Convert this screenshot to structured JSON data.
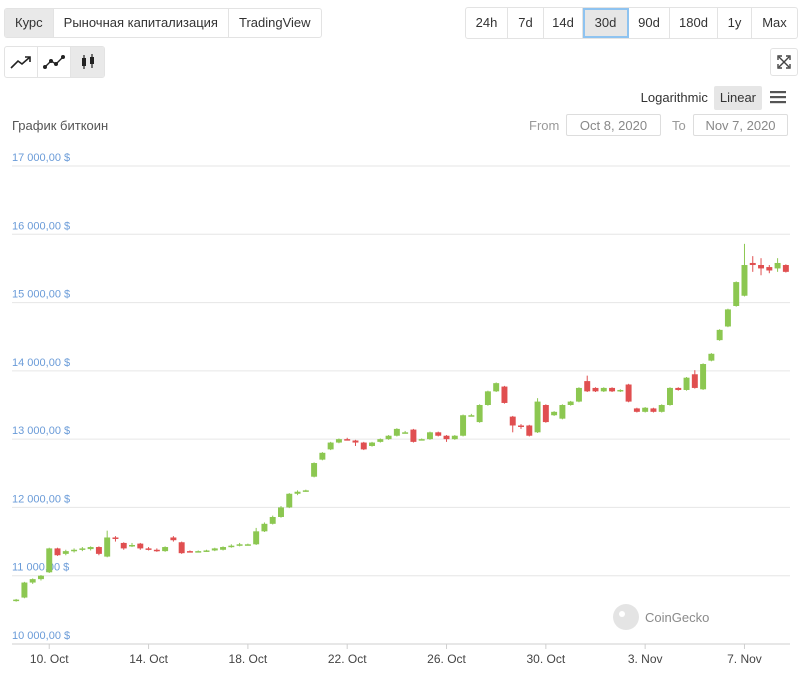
{
  "tabs": [
    "Курс",
    "Рыночная капитализация",
    "TradingView"
  ],
  "ranges": [
    "24h",
    "7d",
    "14d",
    "30d",
    "90d",
    "180d",
    "1y",
    "Max"
  ],
  "selected_range": "30d",
  "chart_types": [
    "line-chart-icon",
    "line-markers-icon",
    "candlestick-icon"
  ],
  "scale": {
    "logarithmic": "Logarithmic",
    "linear": "Linear",
    "active": "linear"
  },
  "title": "График биткоин",
  "from_label": "From",
  "from_value": "Oct 8, 2020",
  "to_label": "To",
  "to_value": "Nov 7, 2020",
  "credit": "CoinGecko",
  "colors": {
    "up": "#8cc751",
    "down": "#e04f50",
    "grid": "#e6e6e6",
    "ytick": "#6a9bd8",
    "selected_border": "#8ec3f0"
  },
  "chart_data": {
    "type": "candlestick",
    "ylim": [
      10000,
      17000
    ],
    "yticks": [
      "10 000,00 $",
      "11 000,00 $",
      "12 000,00 $",
      "13 000,00 $",
      "14 000,00 $",
      "15 000,00 $",
      "16 000,00 $",
      "17 000,00 $"
    ],
    "ytick_values": [
      10000,
      11000,
      12000,
      13000,
      14000,
      15000,
      16000,
      17000
    ],
    "xticks": [
      "10. Oct",
      "14. Oct",
      "18. Oct",
      "22. Oct",
      "26. Oct",
      "30. Oct",
      "3. Nov",
      "7. Nov"
    ],
    "xtick_index": [
      4,
      16,
      28,
      40,
      52,
      64,
      76,
      88
    ],
    "candles": [
      [
        10640,
        10650,
        10620,
        10660
      ],
      [
        10680,
        10900,
        10670,
        10910
      ],
      [
        10900,
        10950,
        10880,
        10960
      ],
      [
        10950,
        11000,
        10930,
        11010
      ],
      [
        11050,
        11400,
        11040,
        11410
      ],
      [
        11400,
        11300,
        11290,
        11410
      ],
      [
        11320,
        11360,
        11300,
        11380
      ],
      [
        11360,
        11380,
        11340,
        11400
      ],
      [
        11380,
        11400,
        11360,
        11420
      ],
      [
        11390,
        11420,
        11370,
        11430
      ],
      [
        11420,
        11320,
        11300,
        11430
      ],
      [
        11280,
        11560,
        11270,
        11660
      ],
      [
        11560,
        11540,
        11500,
        11580
      ],
      [
        11480,
        11400,
        11380,
        11490
      ],
      [
        11430,
        11450,
        11420,
        11480
      ],
      [
        11470,
        11400,
        11380,
        11480
      ],
      [
        11400,
        11380,
        11370,
        11420
      ],
      [
        11380,
        11360,
        11350,
        11400
      ],
      [
        11360,
        11420,
        11350,
        11430
      ],
      [
        11560,
        11520,
        11500,
        11580
      ],
      [
        11490,
        11330,
        11320,
        11500
      ],
      [
        11360,
        11350,
        11340,
        11370
      ],
      [
        11350,
        11360,
        11340,
        11370
      ],
      [
        11360,
        11370,
        11350,
        11380
      ],
      [
        11370,
        11400,
        11360,
        11410
      ],
      [
        11380,
        11420,
        11370,
        11430
      ],
      [
        11420,
        11440,
        11410,
        11460
      ],
      [
        11440,
        11460,
        11430,
        11480
      ],
      [
        11460,
        11460,
        11450,
        11470
      ],
      [
        11460,
        11650,
        11450,
        11700
      ],
      [
        11650,
        11760,
        11640,
        11780
      ],
      [
        11760,
        11860,
        11750,
        11880
      ],
      [
        11860,
        12000,
        11850,
        12020
      ],
      [
        12000,
        12200,
        11990,
        12210
      ],
      [
        12200,
        12230,
        12180,
        12250
      ],
      [
        12240,
        12250,
        12230,
        12260
      ],
      [
        12450,
        12650,
        12440,
        12660
      ],
      [
        12700,
        12800,
        12690,
        12810
      ],
      [
        12850,
        12950,
        12840,
        12960
      ],
      [
        12950,
        13000,
        12940,
        13010
      ],
      [
        13000,
        12990,
        12980,
        13020
      ],
      [
        12980,
        12950,
        12900,
        12990
      ],
      [
        12950,
        12850,
        12840,
        12960
      ],
      [
        12900,
        12950,
        12890,
        12960
      ],
      [
        12960,
        13000,
        12950,
        13010
      ],
      [
        13000,
        13050,
        12990,
        13060
      ],
      [
        13050,
        13150,
        13040,
        13160
      ],
      [
        13100,
        13100,
        13090,
        13120
      ],
      [
        13140,
        12960,
        12950,
        13150
      ],
      [
        13000,
        13000,
        12990,
        13010
      ],
      [
        13000,
        13100,
        12990,
        13110
      ],
      [
        13100,
        13050,
        13040,
        13110
      ],
      [
        13050,
        13000,
        12960,
        13060
      ],
      [
        13000,
        13050,
        12990,
        13060
      ],
      [
        13050,
        13350,
        13040,
        13360
      ],
      [
        13350,
        13350,
        13340,
        13370
      ],
      [
        13250,
        13500,
        13240,
        13510
      ],
      [
        13500,
        13700,
        13490,
        13710
      ],
      [
        13700,
        13820,
        13690,
        13830
      ],
      [
        13770,
        13530,
        13520,
        13780
      ],
      [
        13330,
        13200,
        13100,
        13340
      ],
      [
        13200,
        13180,
        13150,
        13220
      ],
      [
        13200,
        13050,
        13040,
        13210
      ],
      [
        13100,
        13550,
        13090,
        13600
      ],
      [
        13500,
        13250,
        13240,
        13510
      ],
      [
        13350,
        13400,
        13340,
        13410
      ],
      [
        13300,
        13500,
        13290,
        13510
      ],
      [
        13500,
        13550,
        13490,
        13560
      ],
      [
        13550,
        13750,
        13540,
        13760
      ],
      [
        13850,
        13700,
        13690,
        13930
      ],
      [
        13750,
        13700,
        13690,
        13760
      ],
      [
        13700,
        13750,
        13690,
        13760
      ],
      [
        13750,
        13700,
        13690,
        13760
      ],
      [
        13700,
        13720,
        13690,
        13730
      ],
      [
        13800,
        13550,
        13540,
        13810
      ],
      [
        13450,
        13400,
        13390,
        13460
      ],
      [
        13400,
        13460,
        13390,
        13470
      ],
      [
        13450,
        13400,
        13390,
        13460
      ],
      [
        13400,
        13500,
        13390,
        13510
      ],
      [
        13500,
        13750,
        13490,
        13760
      ],
      [
        13750,
        13720,
        13710,
        13760
      ],
      [
        13720,
        13900,
        13710,
        13910
      ],
      [
        13950,
        13750,
        13740,
        14010
      ],
      [
        13730,
        14100,
        13720,
        14110
      ],
      [
        14150,
        14250,
        14140,
        14260
      ],
      [
        14450,
        14600,
        14440,
        14610
      ],
      [
        14650,
        14900,
        14640,
        14910
      ],
      [
        14950,
        15300,
        14940,
        15310
      ],
      [
        15100,
        15550,
        15090,
        15860
      ],
      [
        15580,
        15550,
        15450,
        15680
      ],
      [
        15550,
        15500,
        15400,
        15650
      ],
      [
        15520,
        15470,
        15430,
        15550
      ],
      [
        15500,
        15580,
        15450,
        15650
      ],
      [
        15550,
        15450,
        15440,
        15560
      ]
    ]
  }
}
